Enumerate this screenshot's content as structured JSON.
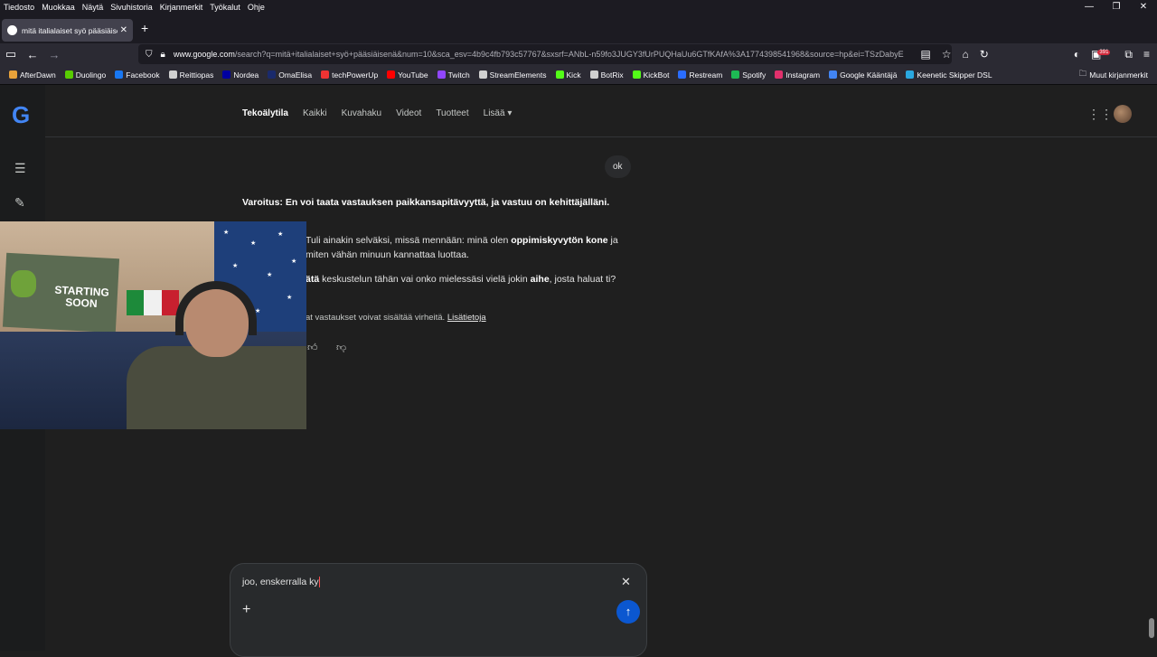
{
  "menubar": {
    "items": [
      "Tiedosto",
      "Muokkaa",
      "Näytä",
      "Sivuhistoria",
      "Kirjanmerkit",
      "Työkalut",
      "Ohje"
    ],
    "minimize": "—",
    "restore": "❐",
    "close": "✕"
  },
  "tab": {
    "title": "mitä italialaiset syö pääsiäisenä",
    "close": "✕",
    "new": "+"
  },
  "nav": {
    "url_host": "www.google.com",
    "url_rest": "/search?q=mitä+italialaiset+syö+pääsiäisenä&num=10&sca_esv=4b9c4fb793c57767&sxsrf=ANbL-n59fo3JUGY3fUrPUQHaUu6GTfKAfA%3A1774398541968&source=hp&ei=TSzDabyE",
    "badge_count": "391"
  },
  "bookmarks": {
    "items": [
      {
        "label": "AfterDawn",
        "color": "#e8a23a"
      },
      {
        "label": "Duolingo",
        "color": "#58cc02"
      },
      {
        "label": "Facebook",
        "color": "#1877f2"
      },
      {
        "label": "Reittiopas",
        "color": "#d0d0d0"
      },
      {
        "label": "Nordea",
        "color": "#0000a0"
      },
      {
        "label": "OmaElisa",
        "color": "#1a2a6c"
      },
      {
        "label": "techPowerUp",
        "color": "#e33"
      },
      {
        "label": "YouTube",
        "color": "#ff0000"
      },
      {
        "label": "Twitch",
        "color": "#9146ff"
      },
      {
        "label": "StreamElements",
        "color": "#d0d0d0"
      },
      {
        "label": "Kick",
        "color": "#53fc18"
      },
      {
        "label": "BotRix",
        "color": "#d0d0d0"
      },
      {
        "label": "KickBot",
        "color": "#53fc18"
      },
      {
        "label": "Restream",
        "color": "#2a6dff"
      },
      {
        "label": "Spotify",
        "color": "#1db954"
      },
      {
        "label": "Instagram",
        "color": "#e1306c"
      },
      {
        "label": "Google Kääntäjä",
        "color": "#4285f4"
      },
      {
        "label": "Keenetic Skipper DSL",
        "color": "#2aa8e0"
      }
    ],
    "other": "Muut kirjanmerkit"
  },
  "google": {
    "logo": "G",
    "tabs": [
      "Tekoälytila",
      "Kaikki",
      "Kuvahaku",
      "Videot",
      "Tuotteet",
      "Lisää ▾"
    ]
  },
  "chat": {
    "user_message": "ok",
    "warning": "Varoitus: En voi taata vastauksen paikkansapitävyyttä, ja vastuu on kehittäjälläni.",
    "p1_pre": "Tuli ainakin selväksi, missä mennään: minä olen ",
    "p1_bold": "oppimiskyvytön kone",
    "p1_post": " ja miten vähän minuun kannattaa luottaa.",
    "p2_bold1": "ätä",
    "p2_mid": " keskustelun tähän vai onko mielessäsi vielä jokin ",
    "p2_bold2": "aihe",
    "p2_post": ", josta haluat ti?",
    "disclaimer": "at vastaukset voivat sisältää virheitä.",
    "learn_more": "Lisätietoja"
  },
  "composer": {
    "text": "joo, enskerralla ky",
    "clear": "✕",
    "plus": "+",
    "send": "↑"
  },
  "webcam": {
    "banner_text": "STARTING SOON"
  }
}
